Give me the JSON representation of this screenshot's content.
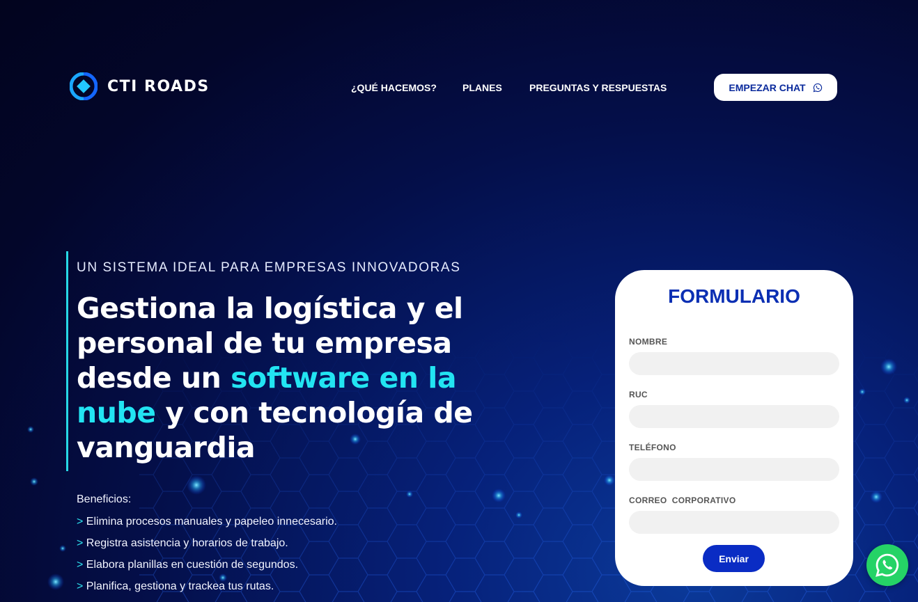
{
  "brand": {
    "name": "CTI ROADS",
    "logo_icon": "cti-roads-logo"
  },
  "nav": {
    "items": [
      {
        "label": "¿QUÉ HACEMOS?"
      },
      {
        "label": "PLANES"
      },
      {
        "label": "PREGUNTAS Y RESPUESTAS"
      }
    ],
    "cta": {
      "label": "EMPEZAR CHAT",
      "icon": "whatsapp-icon"
    }
  },
  "hero": {
    "eyebrow": "UN SISTEMA IDEAL PARA EMPRESAS INNOVADORAS",
    "headline_part1": "Gestiona la logística y el personal de tu empresa desde un ",
    "headline_highlight": "software en la nube",
    "headline_part2": " y con tecnología de vanguardia",
    "benefits_title": "Beneficios:",
    "benefits": [
      "Elimina procesos manuales y papeleo innecesario.",
      "Registra asistencia y horarios de trabajo.",
      "Elabora planillas en cuestión de segundos.",
      "Planifica, gestiona y trackea tus rutas."
    ],
    "bullet": ">"
  },
  "form": {
    "title": "FORMULARIO",
    "fields": [
      {
        "label": "NOMBRE",
        "value": ""
      },
      {
        "label": "RUC",
        "value": ""
      },
      {
        "label": "TELÉFONO",
        "value": ""
      },
      {
        "label": "CORREO  CORPORATIVO",
        "value": ""
      }
    ],
    "submit_label": "Enviar"
  },
  "floating": {
    "icon": "whatsapp-icon"
  },
  "colors": {
    "accent_cyan": "#22e4f2",
    "brand_blue": "#0b2fb3",
    "button_blue": "#0a2cc4",
    "whatsapp_green": "#25d366"
  }
}
